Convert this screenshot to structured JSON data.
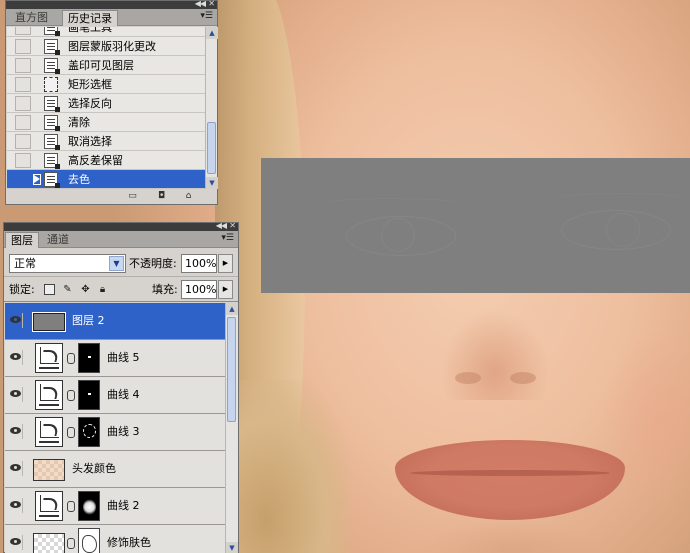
{
  "colors": {
    "selection": "#2f62c8",
    "panel_bg": "#d6d3ce",
    "censor_gray": "#7f7f7f"
  },
  "history_panel": {
    "tabs": [
      {
        "label": "直方图",
        "active": false
      },
      {
        "label": "历史记录",
        "active": true
      }
    ],
    "items": [
      {
        "label": "画笔工具",
        "icon": "history-step-icon",
        "selected": false
      },
      {
        "label": "图层蒙版羽化更改",
        "icon": "history-step-icon",
        "selected": false
      },
      {
        "label": "盖印可见图层",
        "icon": "history-step-icon",
        "selected": false
      },
      {
        "label": "矩形选框",
        "icon": "marquee-icon",
        "selected": false
      },
      {
        "label": "选择反向",
        "icon": "history-step-icon",
        "selected": false
      },
      {
        "label": "清除",
        "icon": "history-step-icon",
        "selected": false
      },
      {
        "label": "取消选择",
        "icon": "history-step-icon",
        "selected": false
      },
      {
        "label": "高反差保留",
        "icon": "history-step-icon",
        "selected": false
      },
      {
        "label": "去色",
        "icon": "history-step-icon",
        "selected": true
      }
    ],
    "footer_icons": [
      "new-document-from-state-icon",
      "new-snapshot-icon",
      "trash-icon"
    ]
  },
  "layers_panel": {
    "tabs": [
      {
        "label": "图层",
        "active": true
      },
      {
        "label": "通道",
        "active": false
      }
    ],
    "blend_mode": "正常",
    "opacity_label": "不透明度:",
    "opacity_value": "100%",
    "lock_label": "锁定:",
    "fill_label": "填充:",
    "fill_value": "100%",
    "lock_icons": [
      "lock-transparent-icon",
      "lock-paint-icon",
      "lock-move-icon",
      "lock-all-icon"
    ],
    "layers": [
      {
        "name": "图层 2",
        "kind": "pixel-gray",
        "selected": true
      },
      {
        "name": "曲线 5",
        "kind": "curves",
        "mask": "dot",
        "selected": false
      },
      {
        "name": "曲线 4",
        "kind": "curves",
        "mask": "dot",
        "selected": false
      },
      {
        "name": "曲线 3",
        "kind": "curves",
        "mask": "ring",
        "selected": false
      },
      {
        "name": "头发颜色",
        "kind": "pixel-checker",
        "selected": false
      },
      {
        "name": "曲线 2",
        "kind": "curves",
        "mask": "blob",
        "selected": false
      },
      {
        "name": "修饰肤色",
        "kind": "pixel-checker-mask",
        "selected": false
      }
    ]
  }
}
